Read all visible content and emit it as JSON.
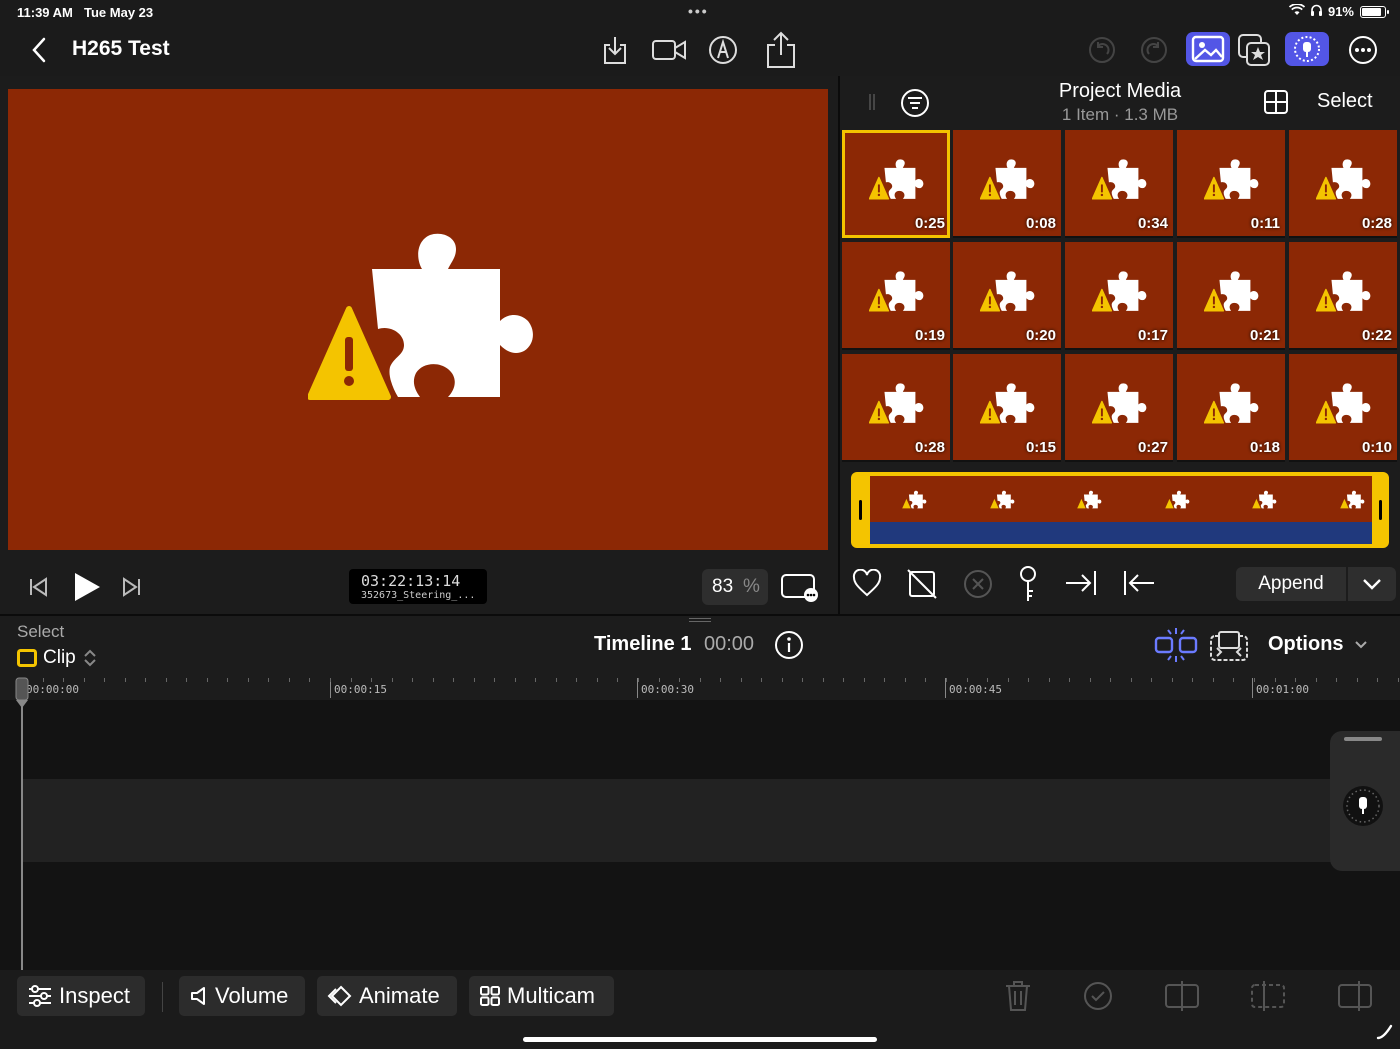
{
  "status_bar": {
    "time": "11:39 AM",
    "date": "Tue May 23",
    "dots": "•••",
    "battery": "91%",
    "battery_level": 0.91
  },
  "nav": {
    "title": "H265 Test"
  },
  "viewer": {
    "timecode": "03:22:13:14",
    "clip_name": "352673_Steering_...",
    "zoom": "83",
    "zoom_unit": "%"
  },
  "browser": {
    "title": "Project Media",
    "subtitle": "1 Item  ·  1.3 MB",
    "select_label": "Select",
    "thumbnails": [
      "0:25",
      "0:08",
      "0:34",
      "0:11",
      "0:28",
      "0:19",
      "0:20",
      "0:17",
      "0:21",
      "0:22",
      "0:28",
      "0:15",
      "0:27",
      "0:18",
      "0:10"
    ],
    "append_label": "Append"
  },
  "timeline": {
    "select_label": "Select",
    "mode_label": "Clip",
    "name": "Timeline 1",
    "time": "00:00",
    "options_label": "Options",
    "ruler": [
      "00:00:00",
      "00:00:15",
      "00:00:30",
      "00:00:45",
      "00:01:00"
    ]
  },
  "toolbar": {
    "inspect": "Inspect",
    "volume": "Volume",
    "animate": "Animate",
    "multicam": "Multicam"
  },
  "colors": {
    "accent_yellow": "#f4c400",
    "media_bg": "#8c2805",
    "highlight": "#5356e6"
  }
}
